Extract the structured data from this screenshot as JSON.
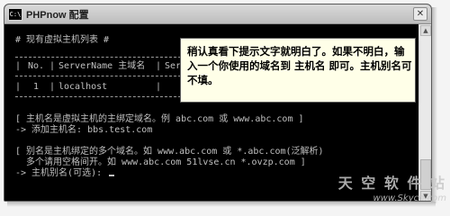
{
  "window": {
    "title": "PHPnow 配置",
    "icon_label": "C:\\",
    "close_glyph": "✕"
  },
  "console": {
    "list_header": "# 现有虚拟主机列表 #",
    "table": {
      "headers": [
        "No.",
        "ServerName 主域名",
        "ServerAl"
      ],
      "rows": [
        [
          "1",
          "localhost",
          ""
        ]
      ]
    },
    "hint1": "[ 主机名是虚拟主机的主绑定域名。例 abc.com 或 www.abc.com ]",
    "prompt1": "-> 添加主机名: bbs.test.com",
    "hint2a": "[ 别名是主机绑定的多个域名。如 www.abc.com 或 *.abc.com(泛解析)",
    "hint2b": "  多个请用空格间开。如 www.abc.com 51lvse.cn *.ovzp.com ]",
    "prompt2": "-> 主机别名(可选): "
  },
  "callout": {
    "text": "稍认真看下提示文字就明白了。如果不明白，输入一个你使用的域名到 主机名 即可。主机别名可不填。"
  },
  "watermark": {
    "cn": "天 空 软 件 站",
    "url": "www.Skycn.com"
  },
  "colors": {
    "console_bg": "#000000",
    "console_fg": "#c0c0c0",
    "callout_bg": "#ffffe8"
  }
}
